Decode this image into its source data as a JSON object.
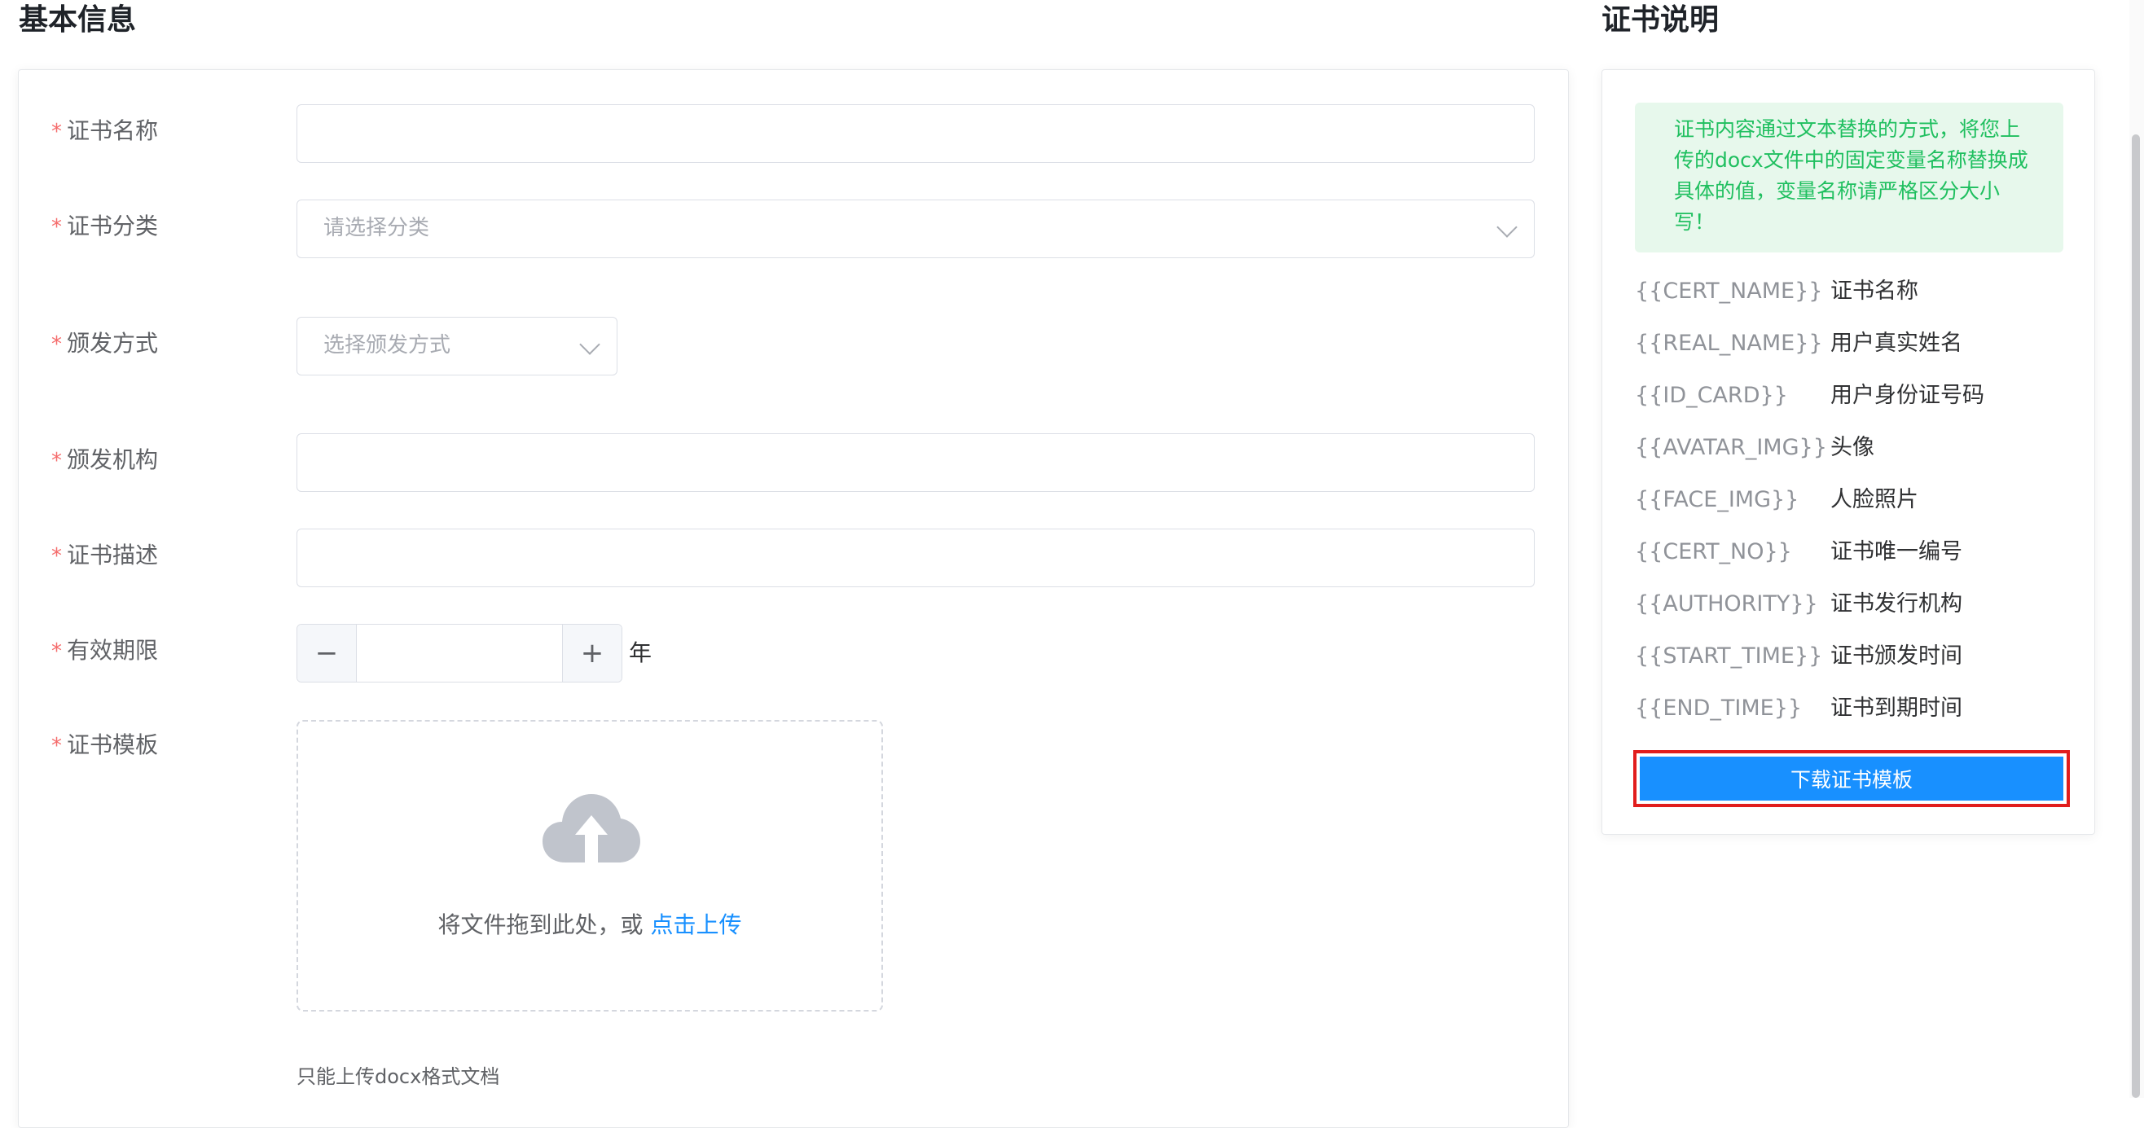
{
  "left_section": {
    "title": "基本信息"
  },
  "right_section": {
    "title": "证书说明"
  },
  "form": {
    "required_mark": "*",
    "cert_name": {
      "label": "证书名称",
      "value": ""
    },
    "cert_category": {
      "label": "证书分类",
      "placeholder": "请选择分类"
    },
    "issue_method": {
      "label": "颁发方式",
      "placeholder": "选择颁发方式"
    },
    "issuing_org": {
      "label": "颁发机构",
      "value": ""
    },
    "cert_desc": {
      "label": "证书描述",
      "value": ""
    },
    "validity": {
      "label": "有效期限",
      "value": "",
      "unit": "年",
      "minus": "−",
      "plus": "+"
    },
    "template": {
      "label": "证书模板",
      "upload_text": "将文件拖到此处，或 ",
      "upload_link": "点击上传",
      "tip": "只能上传docx格式文档"
    }
  },
  "info": {
    "notice": "证书内容通过文本替换的方式，将您上传的docx文件中的固定变量名称替换成具体的值，变量名称请严格区分大小写！",
    "variables": [
      {
        "key": "{{CERT_NAME}}",
        "desc": "证书名称"
      },
      {
        "key": "{{REAL_NAME}}",
        "desc": "用户真实姓名"
      },
      {
        "key": "{{ID_CARD}}",
        "desc": "用户身份证号码"
      },
      {
        "key": "{{AVATAR_IMG}}",
        "desc": "头像"
      },
      {
        "key": "{{FACE_IMG}}",
        "desc": "人脸照片"
      },
      {
        "key": "{{CERT_NO}}",
        "desc": "证书唯一编号"
      },
      {
        "key": "{{AUTHORITY}}",
        "desc": "证书发行机构"
      },
      {
        "key": "{{START_TIME}}",
        "desc": "证书颁发时间"
      },
      {
        "key": "{{END_TIME}}",
        "desc": "证书到期时间"
      }
    ],
    "download_label": "下载证书模板"
  },
  "colors": {
    "primary": "#1890ff",
    "required": "#f56c6c",
    "notice_bg": "#e7f8ec",
    "notice_text": "#1fbf5f",
    "highlight_border": "#e11d1d"
  }
}
